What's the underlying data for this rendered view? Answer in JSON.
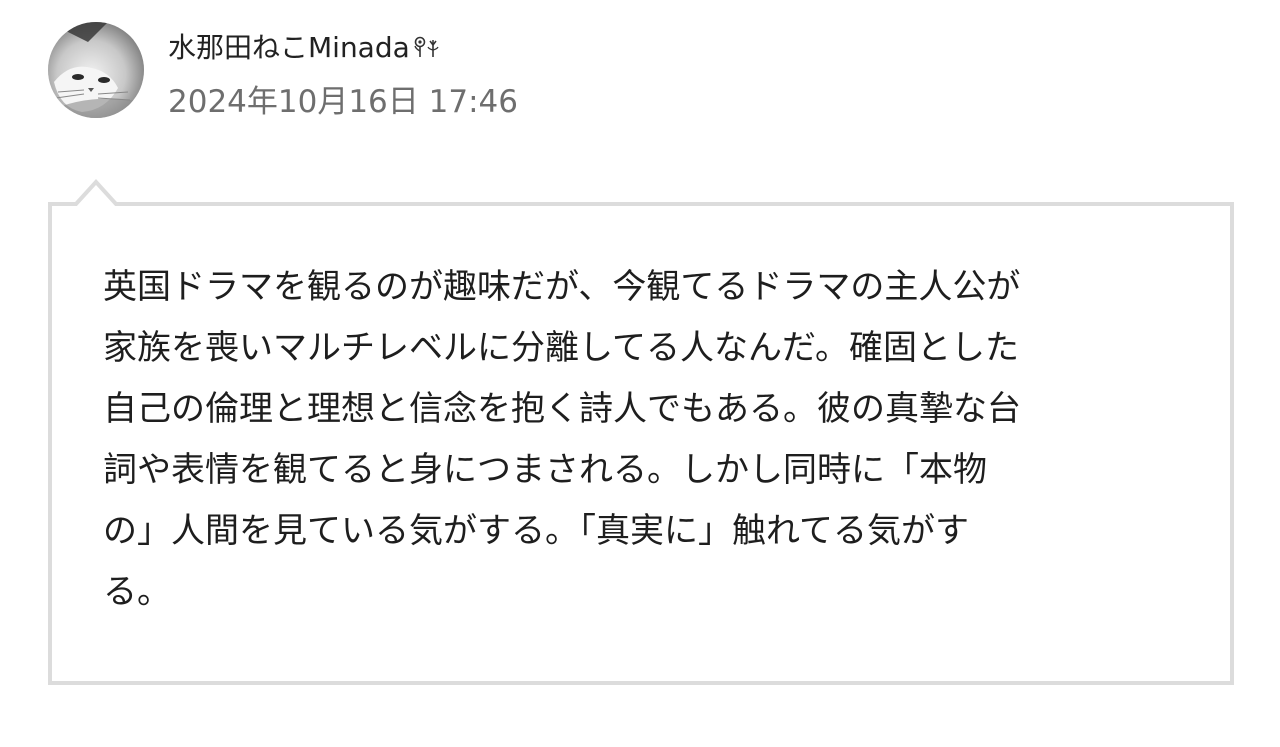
{
  "post": {
    "author": {
      "name": "水那田ねこMinada",
      "avatar": "cat-photo-avatar",
      "name_icon": "flower-emoji-icon"
    },
    "timestamp": "2024年10月16日 17:46",
    "comment": "英国ドラマを観るのが趣味だが、今観てるドラマの主人公が\n家族を喪いマルチレベルに分離してる人なんだ。確固とした\n自己の倫理と理想と信念を抱く詩人でもある。彼の真摯な台\n詞や表情を観てると身につまされる。しかし同時に「本物\nの」人間を見ている気がする。「真実に」触れてる気がす\nる。"
  },
  "colors": {
    "text": "#1e1e1e",
    "timestamp": "#6e6e6e",
    "bubble_border": "#dcdcdc",
    "background": "#ffffff"
  }
}
